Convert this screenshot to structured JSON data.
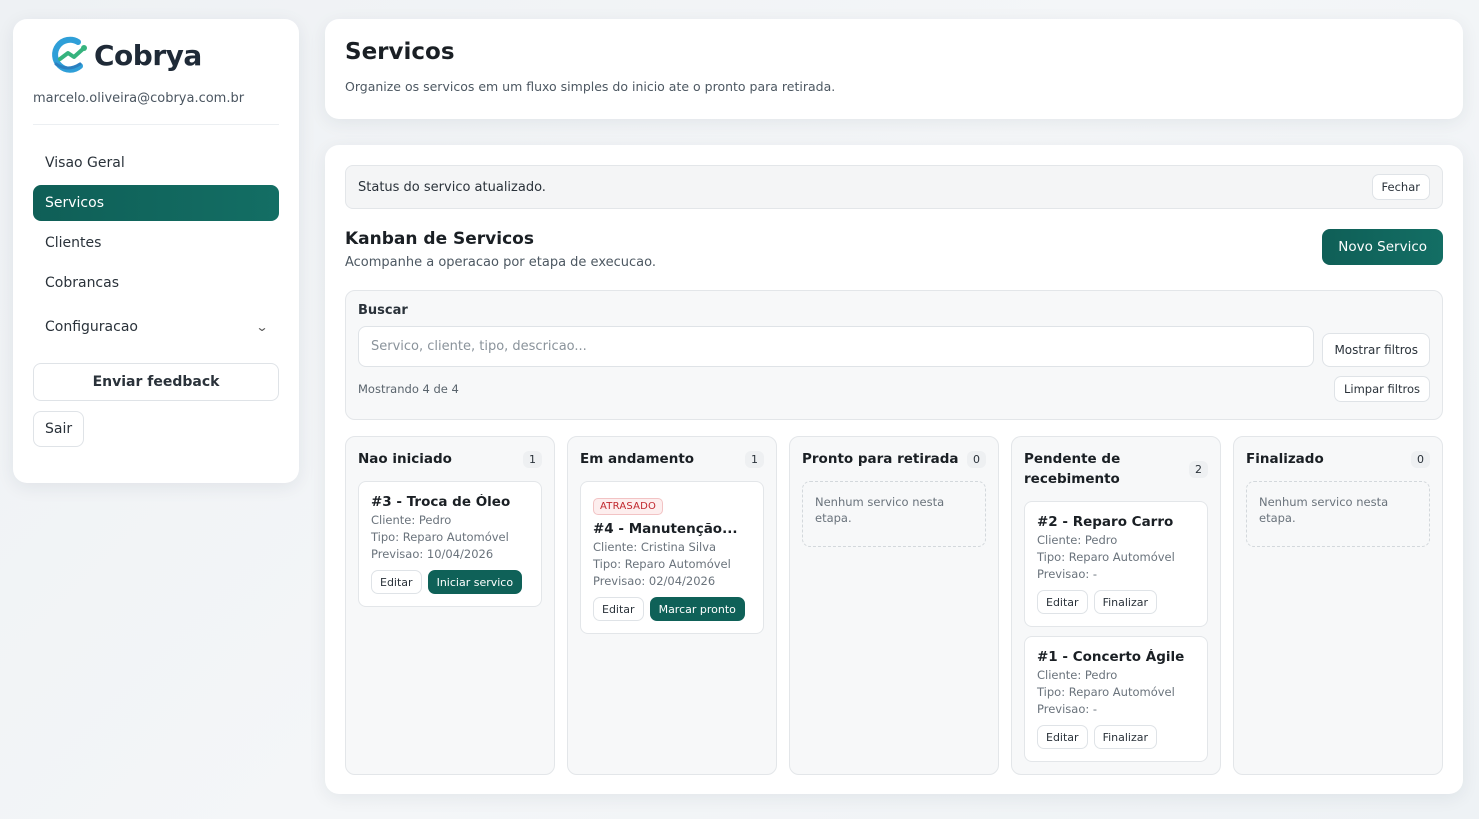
{
  "brand": {
    "name": "Cobrya",
    "accent": "#0f5f57"
  },
  "sidebar": {
    "email": "marcelo.oliveira@cobrya.com.br",
    "items": [
      {
        "label": "Visao Geral",
        "active": false
      },
      {
        "label": "Servicos",
        "active": true
      },
      {
        "label": "Clientes",
        "active": false
      },
      {
        "label": "Cobrancas",
        "active": false
      }
    ],
    "config_label": "Configuracao",
    "feedback_label": "Enviar feedback",
    "logout_label": "Sair"
  },
  "header": {
    "title": "Servicos",
    "subtitle": "Organize os servicos em um fluxo simples do inicio ate o pronto para retirada."
  },
  "status": {
    "message": "Status do servico atualizado.",
    "close_label": "Fechar"
  },
  "kanban": {
    "title": "Kanban de Servicos",
    "subtitle": "Acompanhe a operacao por etapa de execucao.",
    "new_label": "Novo Servico"
  },
  "search": {
    "label": "Buscar",
    "placeholder": "Servico, cliente, tipo, descricao...",
    "show_filters_label": "Mostrar filtros",
    "showing": "Mostrando 4 de 4",
    "clear_label": "Limpar filtros"
  },
  "columns": [
    {
      "title": "Nao iniciado",
      "count": "1",
      "tasks": [
        {
          "late": "",
          "title": "#3 - Troca de Óleo",
          "client": "Cliente: Pedro",
          "type": "Tipo: Reparo Automóvel",
          "forecast": "Previsao: 10/04/2026",
          "edit": "Editar",
          "action": "Iniciar servico"
        }
      ]
    },
    {
      "title": "Em andamento",
      "count": "1",
      "tasks": [
        {
          "late": "ATRASADO",
          "title": "#4 - Manutenção...",
          "client": "Cliente: Cristina Silva",
          "type": "Tipo: Reparo Automóvel",
          "forecast": "Previsao: 02/04/2026",
          "edit": "Editar",
          "action": "Marcar pronto"
        }
      ]
    },
    {
      "title": "Pronto para retirada",
      "count": "0",
      "empty": "Nenhum servico nesta etapa.",
      "tasks": []
    },
    {
      "title": "Pendente de recebimento",
      "count": "2",
      "tasks": [
        {
          "late": "",
          "title": "#2 - Reparo Carro",
          "client": "Cliente: Pedro",
          "type": "Tipo: Reparo Automóvel",
          "forecast": "Previsao: -",
          "edit": "Editar",
          "action": "Finalizar"
        },
        {
          "late": "",
          "title": "#1 - Concerto Ágile",
          "client": "Cliente: Pedro",
          "type": "Tipo: Reparo Automóvel",
          "forecast": "Previsao: -",
          "edit": "Editar",
          "action": "Finalizar"
        }
      ]
    },
    {
      "title": "Finalizado",
      "count": "0",
      "empty": "Nenhum servico nesta etapa.",
      "tasks": []
    }
  ]
}
